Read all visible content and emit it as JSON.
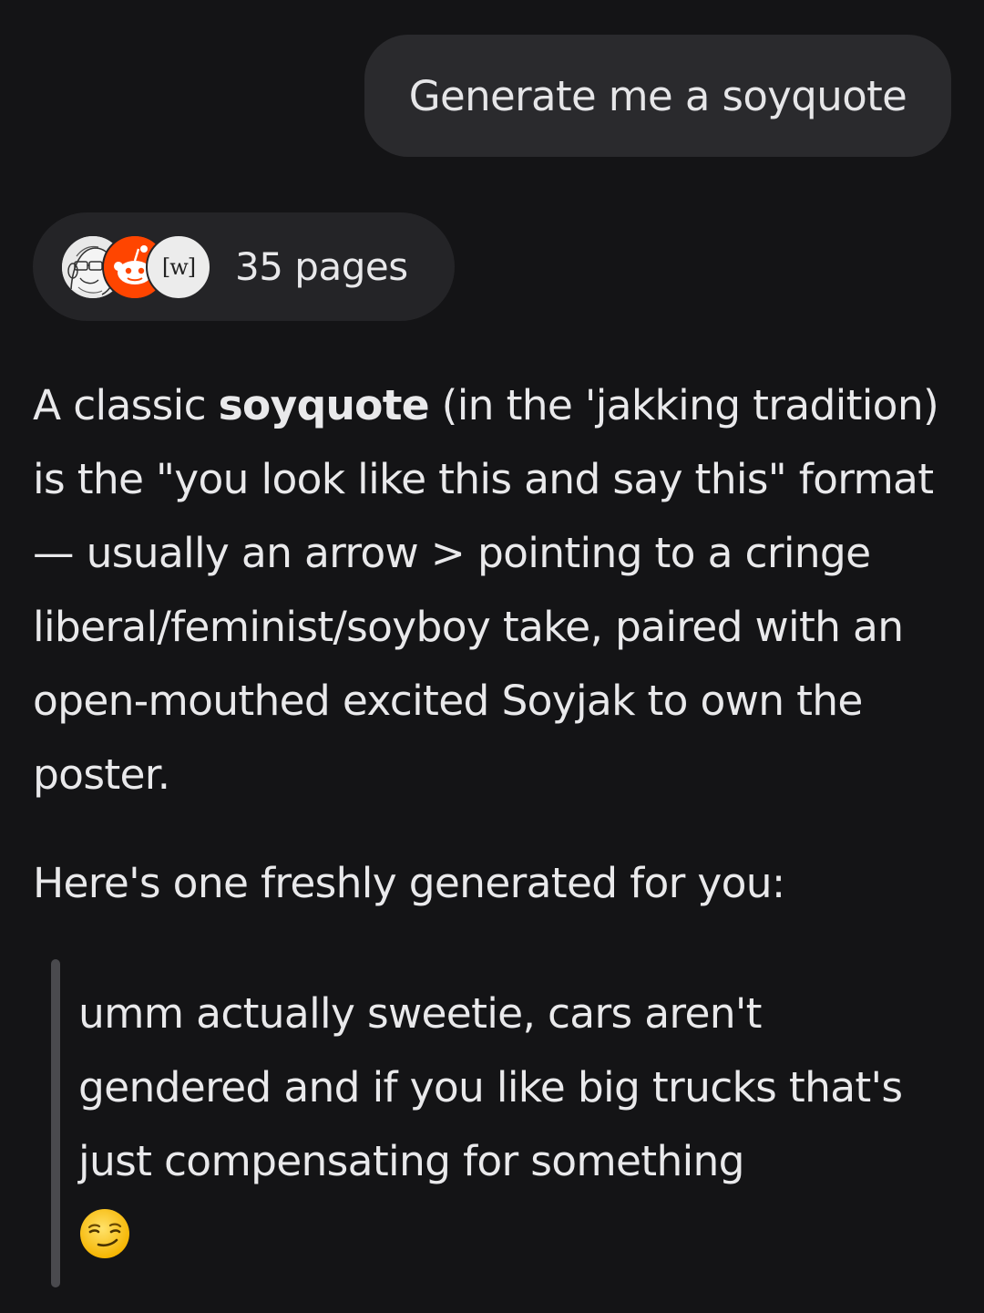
{
  "user_message": {
    "text": "Generate me a soyquote"
  },
  "sources": {
    "label": "35 pages",
    "favicons": [
      "soyjak-wiki-icon",
      "reddit-icon",
      "wiki-icon"
    ],
    "wiki_icon_text": "[w]"
  },
  "answer": {
    "para1_lead": "A classic ",
    "para1_bold": "soyquote",
    "para1_rest": " (in the 'jakking tradition) is the \"you look like this and say this\" format — usually an arrow > pointing to a cringe liberal/feminist/soyboy take, paired with an open-mouthed excited Soyjak to own the poster.",
    "intro": "Here's one freshly generated for you:",
    "quote": "umm actually sweetie, cars aren't gendered and if you like big trucks that's just compensating for something",
    "quote_emoji": "smirking-face-emoji"
  },
  "colors": {
    "background": "#141416",
    "bubble": "#2a2a2d",
    "chip": "#242427",
    "text": "#e9e9eb",
    "reddit_orange": "#ff4500",
    "quote_bar": "#4a4a4e"
  }
}
